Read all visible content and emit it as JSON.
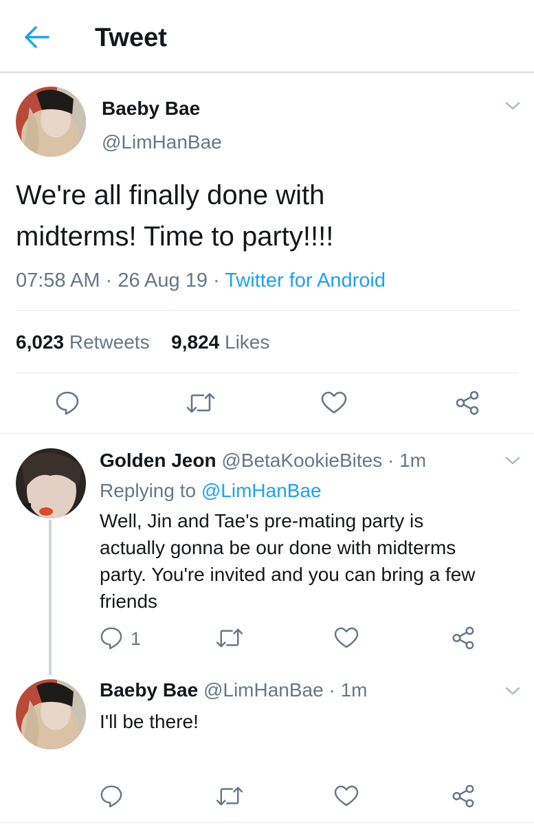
{
  "header": {
    "title": "Tweet",
    "back_icon": "arrow-left-icon"
  },
  "main_tweet": {
    "author_name": "Baeby Bae",
    "author_handle": "@LimHanBae",
    "text_line1": "We're all finally done with",
    "text_line2": "midterms! Time to party!!!!",
    "time": "07:58 AM",
    "sep1": "·",
    "date": "26 Aug 19",
    "sep2": "·",
    "source": "Twitter for Android",
    "retweets_count": "6,023",
    "retweets_label": "Retweets",
    "likes_count": "9,824",
    "likes_label": "Likes"
  },
  "replies": [
    {
      "author_name": "Golden Jeon",
      "author_handle": "@BetaKookieBites",
      "sep": "·",
      "time": "1m",
      "replying_label": "Replying to",
      "replying_to": "@LimHanBae",
      "text_lines": [
        "Well, Jin and Tae's pre-mating party is",
        "actually gonna be our done with midterms",
        "party. You're invited and you can bring a few",
        "friends"
      ],
      "reply_count": "1"
    },
    {
      "author_name": "Baeby Bae",
      "author_handle": "@LimHanBae",
      "sep": "·",
      "time": "1m",
      "text_lines": [
        "I'll be there!"
      ],
      "reply_count": ""
    }
  ],
  "colors": {
    "accent": "#1da1f2",
    "secondary_text": "#657786",
    "divider": "#e1e8ed"
  },
  "icons": [
    "reply-icon",
    "retweet-icon",
    "like-icon",
    "share-icon",
    "chevron-down-icon"
  ]
}
